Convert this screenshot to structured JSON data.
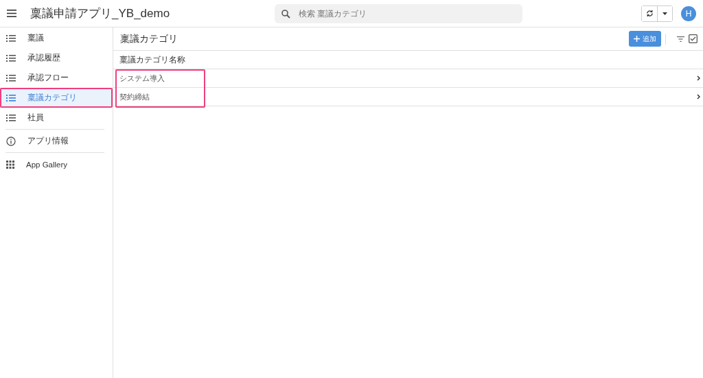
{
  "app_title": "稟議申請アプリ_YB_demo",
  "search": {
    "placeholder": "検索 稟議カテゴリ"
  },
  "avatar": "H",
  "sidebar": {
    "groups": [
      [
        {
          "label": "稟議",
          "kind": "list",
          "selected": false,
          "highlighted": false
        },
        {
          "label": "承認履歴",
          "kind": "list",
          "selected": false,
          "highlighted": false
        },
        {
          "label": "承認フロー",
          "kind": "list",
          "selected": false,
          "highlighted": false
        },
        {
          "label": "稟議カテゴリ",
          "kind": "list",
          "selected": true,
          "highlighted": true
        },
        {
          "label": "社員",
          "kind": "list",
          "selected": false,
          "highlighted": false
        }
      ],
      [
        {
          "label": "アプリ情報",
          "kind": "info",
          "selected": false,
          "highlighted": false
        }
      ],
      [
        {
          "label": "App Gallery",
          "kind": "grid",
          "selected": false,
          "highlighted": false
        }
      ]
    ]
  },
  "view": {
    "title": "稟議カテゴリ",
    "add_button": "追加",
    "table": {
      "columns": [
        "稟議カテゴリ名称"
      ],
      "rows_highlighted": true,
      "rows": [
        {
          "name": "システム導入"
        },
        {
          "name": "契約締結"
        }
      ]
    }
  }
}
